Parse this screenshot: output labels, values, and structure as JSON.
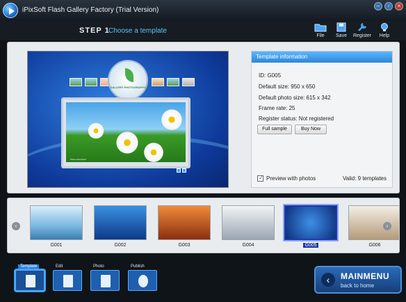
{
  "window": {
    "title": "iPixSoft Flash Gallery Factory (Trial Version)"
  },
  "header": {
    "step": "STEP 1",
    "step_title": "Choose a template",
    "tools": [
      {
        "label": "File",
        "icon": "folder-icon"
      },
      {
        "label": "Save",
        "icon": "save-icon"
      },
      {
        "label": "Register",
        "icon": "wrench-icon"
      },
      {
        "label": "Help",
        "icon": "help-bulb-icon"
      }
    ]
  },
  "preview": {
    "badge_text": "GALLERY PHOTOGRAPHY",
    "caption": "Photo description"
  },
  "template_info": {
    "title": "Template information",
    "id": "ID: G005",
    "default_size": "Default size: 950 x 650",
    "default_photo_size": "Default photo size: 615 x 342",
    "frame_rate": "Frame rate: 25",
    "register_status": "Register status: Not registered",
    "full_sample": "Full sample",
    "buy_now": "Buy Now",
    "preview_with_photos": "Preview with photos",
    "preview_checked": true,
    "valid": "Valid: 9 templates"
  },
  "gallery": {
    "items": [
      "G001",
      "G002",
      "G003",
      "G004",
      "G005",
      "G006"
    ],
    "selected": "G005"
  },
  "bottom_nav": {
    "items": [
      "Template",
      "Edit",
      "Photo",
      "Publish"
    ],
    "active": "Template",
    "mainmenu_title": "MAINMENU",
    "mainmenu_sub": "back to home"
  },
  "colors": {
    "accent": "#2d86d6",
    "selection": "#1a3aa8",
    "step_title": "#5fc4ff"
  }
}
